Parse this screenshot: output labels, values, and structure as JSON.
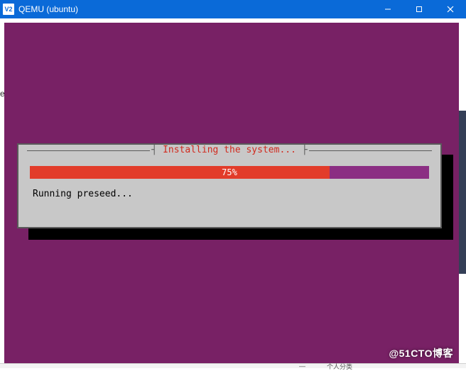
{
  "titlebar": {
    "icon_text": "V2",
    "title": "QEMU (ubuntu)"
  },
  "installer": {
    "legend": "Installing the system...",
    "progress_percent": 75,
    "progress_label": "75%",
    "status": "Running preseed..."
  },
  "watermark": "@51CTO博客",
  "colors": {
    "titlebar_bg": "#0a6ad8",
    "desktop_bg": "#782165",
    "dialog_bg": "#c8c8c8",
    "progress_fill": "#e23c2a",
    "progress_track": "#8b2e83",
    "legend_text": "#d12a1e"
  }
}
